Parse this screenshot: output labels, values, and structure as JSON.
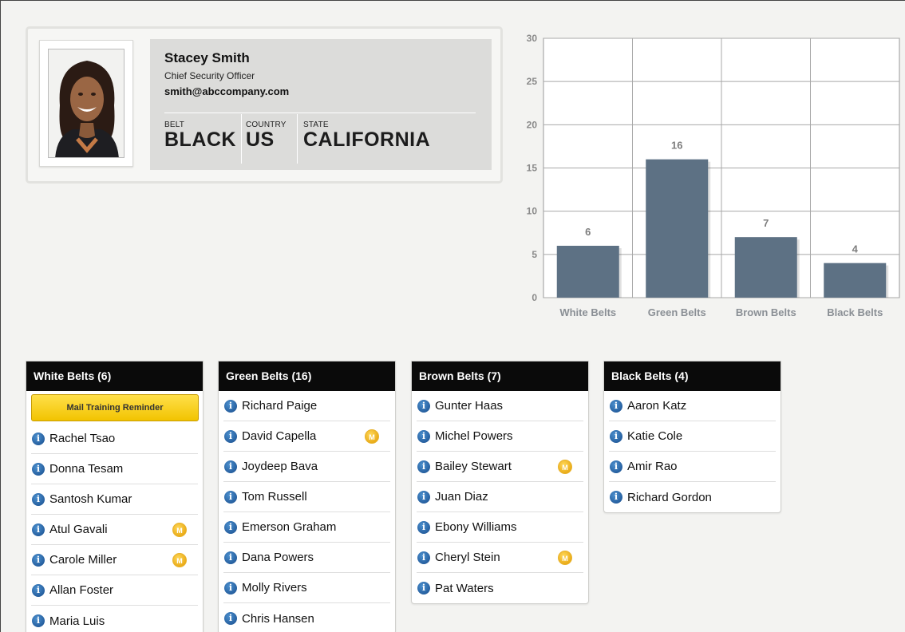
{
  "profile": {
    "name": "Stacey Smith",
    "title": "Chief Security Officer",
    "email": "smith@abccompany.com",
    "fields": [
      {
        "label": "BELT",
        "value": "BLACK"
      },
      {
        "label": "COUNTRY",
        "value": "US"
      },
      {
        "label": "STATE",
        "value": "CALIFORNIA"
      }
    ]
  },
  "chart_data": {
    "type": "bar",
    "categories": [
      "White Belts",
      "Green Belts",
      "Brown Belts",
      "Black Belts"
    ],
    "values": [
      6,
      16,
      7,
      4
    ],
    "ylim": [
      0,
      30
    ],
    "yticks": [
      0,
      5,
      10,
      15,
      20,
      25,
      30
    ],
    "bar_color": "#5d7184",
    "grid": true
  },
  "panels": [
    {
      "title": "White Belts (6)",
      "button": "Mail Training Reminder",
      "members": [
        {
          "name": "Rachel Tsao",
          "badge": ""
        },
        {
          "name": "Donna Tesam",
          "badge": ""
        },
        {
          "name": "Santosh Kumar",
          "badge": ""
        },
        {
          "name": "Atul Gavali",
          "badge": "M"
        },
        {
          "name": "Carole Miller",
          "badge": "M"
        },
        {
          "name": "Allan Foster",
          "badge": ""
        },
        {
          "name": "Maria Luis",
          "badge": ""
        }
      ]
    },
    {
      "title": "Green Belts (16)",
      "members": [
        {
          "name": "Richard Paige",
          "badge": ""
        },
        {
          "name": "David Capella",
          "badge": "M"
        },
        {
          "name": "Joydeep Bava",
          "badge": ""
        },
        {
          "name": "Tom Russell",
          "badge": ""
        },
        {
          "name": "Emerson Graham",
          "badge": ""
        },
        {
          "name": "Dana Powers",
          "badge": ""
        },
        {
          "name": "Molly Rivers",
          "badge": ""
        },
        {
          "name": "Chris Hansen",
          "badge": ""
        }
      ]
    },
    {
      "title": "Brown Belts (7)",
      "members": [
        {
          "name": "Gunter Haas",
          "badge": ""
        },
        {
          "name": "Michel Powers",
          "badge": ""
        },
        {
          "name": "Bailey Stewart",
          "badge": "M"
        },
        {
          "name": "Juan Diaz",
          "badge": ""
        },
        {
          "name": "Ebony Williams",
          "badge": ""
        },
        {
          "name": "Cheryl Stein",
          "badge": "M"
        },
        {
          "name": "Pat Waters",
          "badge": ""
        }
      ]
    },
    {
      "title": "Black Belts (4)",
      "members": [
        {
          "name": "Aaron Katz",
          "badge": ""
        },
        {
          "name": "Katie Cole",
          "badge": ""
        },
        {
          "name": "Amir Rao",
          "badge": ""
        },
        {
          "name": "Richard Gordon",
          "badge": ""
        }
      ]
    }
  ],
  "icons": {
    "info": "i",
    "mail_badge": "M"
  }
}
